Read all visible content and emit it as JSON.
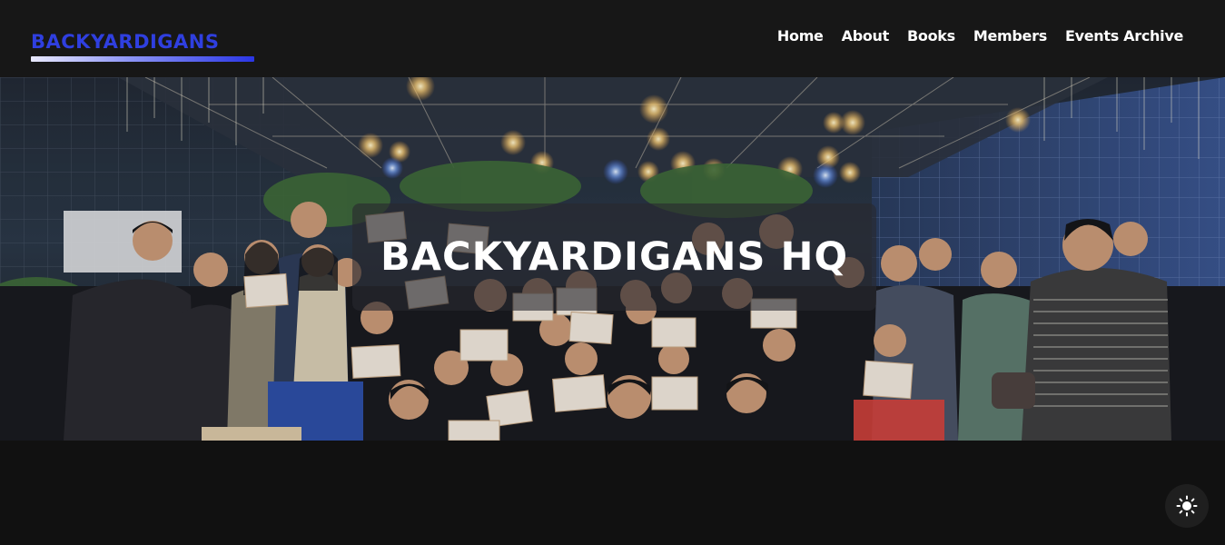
{
  "site": {
    "logo_text": "BACKYARDIGANS",
    "brand_color": "#2f3fe0"
  },
  "nav": {
    "items": [
      {
        "label": "Home"
      },
      {
        "label": "About"
      },
      {
        "label": "Books"
      },
      {
        "label": "Members"
      },
      {
        "label": "Events Archive"
      }
    ]
  },
  "hero": {
    "title": "BACKYARDIGANS HQ",
    "image_subject": "group-photo"
  },
  "theme_toggle": {
    "icon": "sun-icon"
  },
  "colors": {
    "background": "#111111",
    "header": "#171717",
    "text": "#ffffff"
  }
}
